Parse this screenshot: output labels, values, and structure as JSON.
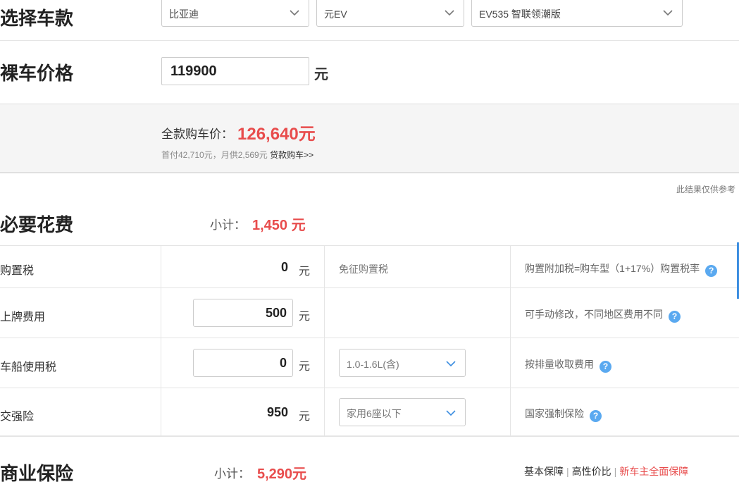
{
  "select_car": {
    "title": "选择车款",
    "brand": "比亚迪",
    "series": "元EV",
    "model": "EV535 智联领潮版"
  },
  "bare_price": {
    "title": "裸车价格",
    "value": "119900",
    "unit": "元"
  },
  "summary": {
    "label": "全款购车价：",
    "total": "126,640元",
    "sub_text": "首付42,710元，月供2,569元",
    "loan_link": "贷款购车>>"
  },
  "note": "此结果仅供参考",
  "required": {
    "title": "必要花费",
    "subtotal_label": "小计：",
    "subtotal_value": "1,450 元",
    "rows": [
      {
        "name": "购置税",
        "value": "0",
        "unit": "元",
        "mid": "免征购置税",
        "desc": "购置附加税=购车型（1+17%）购置税率"
      },
      {
        "name": "上牌费用",
        "value": "500",
        "unit": "元",
        "mid": "",
        "desc": "可手动修改，不同地区费用不同"
      },
      {
        "name": "车船使用税",
        "value": "0",
        "unit": "元",
        "mid": "1.0-1.6L(含)",
        "desc": "按排量收取费用"
      },
      {
        "name": "交强险",
        "value": "950",
        "unit": "元",
        "mid": "家用6座以下",
        "desc": "国家强制保险"
      }
    ]
  },
  "commercial": {
    "title": "商业保险",
    "subtotal_label": "小计：",
    "subtotal_value": "5,290元",
    "links": [
      "基本保障",
      "高性价比",
      "新车主全面保障"
    ]
  },
  "colors": {
    "accent_red": "#e84c4c",
    "help_blue": "#5aa9f0"
  },
  "icons": {
    "dropdown": "chevron-down-icon",
    "help": "question-icon"
  }
}
